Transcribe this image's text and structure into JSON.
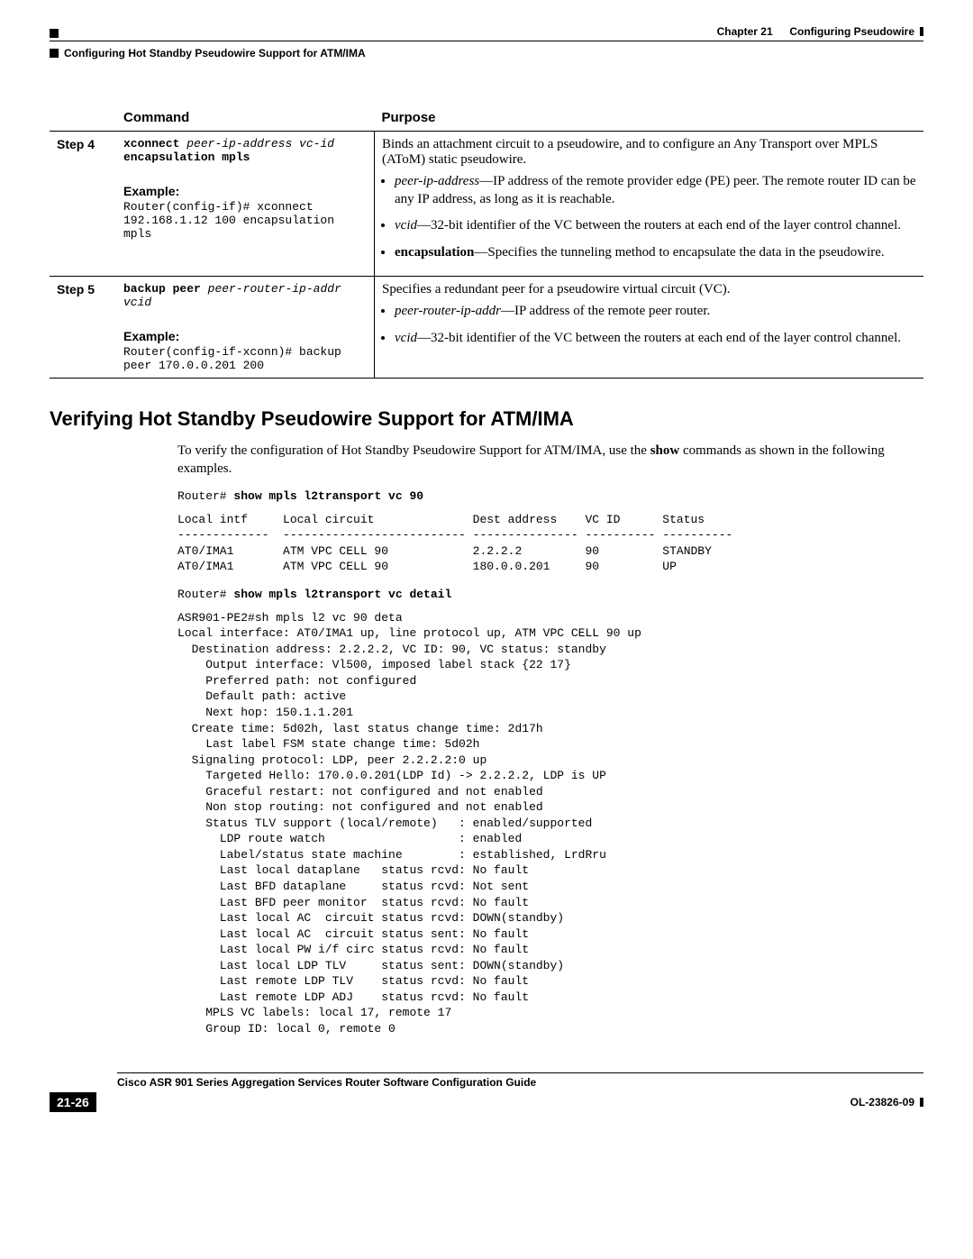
{
  "header": {
    "chapter_label": "Chapter 21",
    "chapter_title": "Configuring Pseudowire",
    "section_title": "Configuring Hot Standby Pseudowire Support for ATM/IMA"
  },
  "table": {
    "head_command": "Command",
    "head_purpose": "Purpose",
    "rows": [
      {
        "step": "Step 4",
        "cmd_bold": "xconnect",
        "cmd_args": "peer-ip-address vc-id",
        "cmd_line2": "encapsulation mpls",
        "example_label": "Example:",
        "example_l1": "Router(config-if)# xconnect",
        "example_l2": "192.168.1.12 100 encapsulation mpls",
        "purpose_lead": "Binds an attachment circuit to a pseudowire, and to configure an Any Transport over MPLS (AToM) static pseudowire.",
        "b1_term": "peer-ip-address",
        "b1_rest": "—IP address of the remote provider edge (PE) peer. The remote router ID can be any IP address, as long as it is reachable.",
        "b2_term": "vcid",
        "b2_rest": "—32-bit identifier of the VC between the routers at each end of the layer control channel.",
        "b3_term": "encapsulation",
        "b3_rest": "—Specifies the tunneling method to encapsulate the data in the pseudowire."
      },
      {
        "step": "Step 5",
        "cmd_bold": "backup peer",
        "cmd_args": "peer-router-ip-addr",
        "cmd_line2": "vcid",
        "example_label": "Example:",
        "example_l1": "Router(config-if-xconn)# backup",
        "example_l2": "peer 170.0.0.201 200",
        "purpose_lead": "Specifies a redundant peer for a pseudowire virtual circuit (VC).",
        "b1_term": "peer-router-ip-addr",
        "b1_rest": "—IP address of the remote peer router.",
        "b2_term": "vcid",
        "b2_rest": "—32-bit identifier of the VC between the routers at each end of the layer control channel."
      }
    ]
  },
  "heading": "Verifying Hot Standby Pseudowire Support for ATM/IMA",
  "para_pre": "To verify the configuration of Hot Standby Pseudowire Support for ATM/IMA, use the ",
  "para_bold": "show",
  "para_post": " commands as shown in the following examples.",
  "cmd1_prompt": "Router# ",
  "cmd1_text": "show mpls l2transport vc 90",
  "cli1": "Local intf     Local circuit              Dest address    VC ID      Status\n-------------  -------------------------- --------------- ---------- ----------\nAT0/IMA1       ATM VPC CELL 90            2.2.2.2         90         STANDBY\nAT0/IMA1       ATM VPC CELL 90            180.0.0.201     90         UP",
  "cmd2_prompt": "Router# ",
  "cmd2_text": "show mpls l2transport vc detail",
  "cli2": "ASR901-PE2#sh mpls l2 vc 90 deta\nLocal interface: AT0/IMA1 up, line protocol up, ATM VPC CELL 90 up\n  Destination address: 2.2.2.2, VC ID: 90, VC status: standby\n    Output interface: Vl500, imposed label stack {22 17}\n    Preferred path: not configured\n    Default path: active\n    Next hop: 150.1.1.201\n  Create time: 5d02h, last status change time: 2d17h\n    Last label FSM state change time: 5d02h\n  Signaling protocol: LDP, peer 2.2.2.2:0 up\n    Targeted Hello: 170.0.0.201(LDP Id) -> 2.2.2.2, LDP is UP\n    Graceful restart: not configured and not enabled\n    Non stop routing: not configured and not enabled\n    Status TLV support (local/remote)   : enabled/supported\n      LDP route watch                   : enabled\n      Label/status state machine        : established, LrdRru\n      Last local dataplane   status rcvd: No fault\n      Last BFD dataplane     status rcvd: Not sent\n      Last BFD peer monitor  status rcvd: No fault\n      Last local AC  circuit status rcvd: DOWN(standby)\n      Last local AC  circuit status sent: No fault\n      Last local PW i/f circ status rcvd: No fault\n      Last local LDP TLV     status sent: DOWN(standby)\n      Last remote LDP TLV    status rcvd: No fault\n      Last remote LDP ADJ    status rcvd: No fault\n    MPLS VC labels: local 17, remote 17\n    Group ID: local 0, remote 0",
  "footer": {
    "guide_title": "Cisco ASR 901 Series Aggregation Services Router Software Configuration Guide",
    "page_num": "21-26",
    "doc_id": "OL-23826-09"
  }
}
